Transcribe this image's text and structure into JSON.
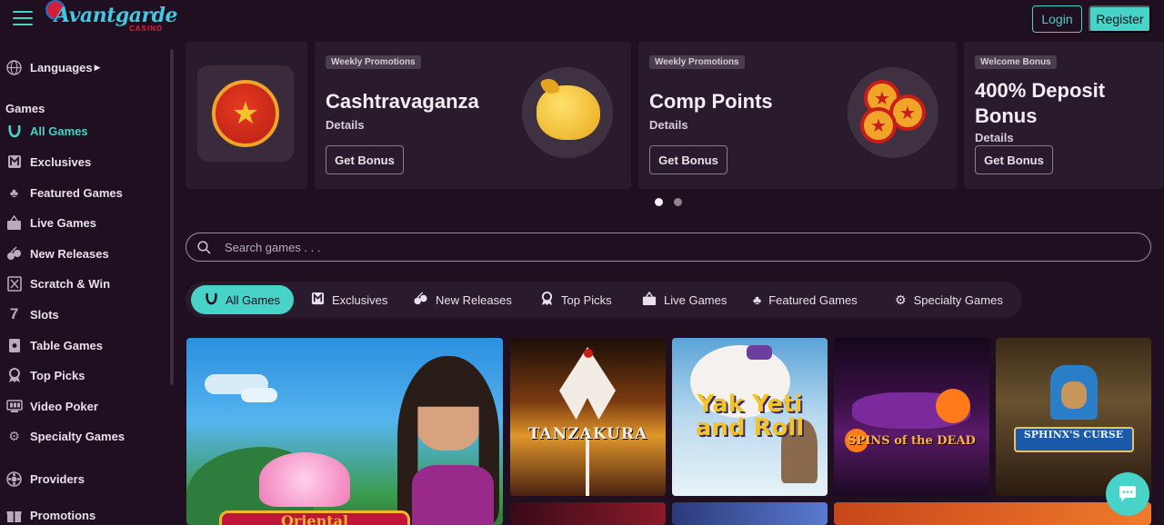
{
  "brand": {
    "name": "Avantgarde",
    "sub": "CASINO"
  },
  "header": {
    "login_label": "Login",
    "register_label": "Register"
  },
  "sidebar": {
    "languages_label": "Languages",
    "games_heading": "Games",
    "items": [
      {
        "label": "All Games",
        "icon": "horseshoe-icon",
        "active": true
      },
      {
        "label": "Exclusives",
        "icon": "exclusive-icon"
      },
      {
        "label": "Featured Games",
        "icon": "clover-icon"
      },
      {
        "label": "Live Games",
        "icon": "live-icon"
      },
      {
        "label": "New Releases",
        "icon": "cherries-icon"
      },
      {
        "label": "Scratch & Win",
        "icon": "scratch-icon"
      },
      {
        "label": "Slots",
        "icon": "seven-icon"
      },
      {
        "label": "Table Games",
        "icon": "cards-icon"
      },
      {
        "label": "Top Picks",
        "icon": "ribbon-icon"
      },
      {
        "label": "Video Poker",
        "icon": "video-poker-icon"
      },
      {
        "label": "Specialty Games",
        "icon": "gear-icon"
      }
    ],
    "providers_label": "Providers",
    "promotions_label": "Promotions"
  },
  "promos": [
    {
      "tag": "Weekly Promotions",
      "title": "Cashtravaganza",
      "details": "Details",
      "button": "Get Bonus",
      "art": "piggy-bank-icon"
    },
    {
      "tag": "Weekly Promotions",
      "title": "Comp Points",
      "details": "Details",
      "button": "Get Bonus",
      "art": "coins-icon"
    },
    {
      "tag": "Welcome Bonus",
      "title": "400% Deposit Bonus",
      "details": "Details",
      "button": "Get Bonus",
      "art": ""
    }
  ],
  "carousel": {
    "pages": 2,
    "active": 1
  },
  "search": {
    "placeholder": "Search games . . ."
  },
  "categories": [
    {
      "label": "All Games",
      "icon": "horseshoe-icon",
      "active": true
    },
    {
      "label": "Exclusives",
      "icon": "exclusive-icon"
    },
    {
      "label": "New Releases",
      "icon": "cherries-icon"
    },
    {
      "label": "Top Picks",
      "icon": "ribbon-icon"
    },
    {
      "label": "Live Games",
      "icon": "live-icon"
    },
    {
      "label": "Featured Games",
      "icon": "clover-icon"
    },
    {
      "label": "Specialty Games",
      "icon": "gear-icon"
    }
  ],
  "games": [
    {
      "title": "Oriental",
      "name": "oriental"
    },
    {
      "title": "TANZAKURA",
      "name": "tanzakura"
    },
    {
      "title": "Yak Yeti and Roll",
      "name": "yak-yeti-roll"
    },
    {
      "title": "SPINS of the DEAD",
      "name": "spins-of-the-dead"
    },
    {
      "title": "SPHINX'S CURSE",
      "name": "sphinxs-curse"
    }
  ],
  "colors": {
    "background": "#1f0f21",
    "accent": "#47d3c8",
    "card": "#2a1a2d"
  }
}
